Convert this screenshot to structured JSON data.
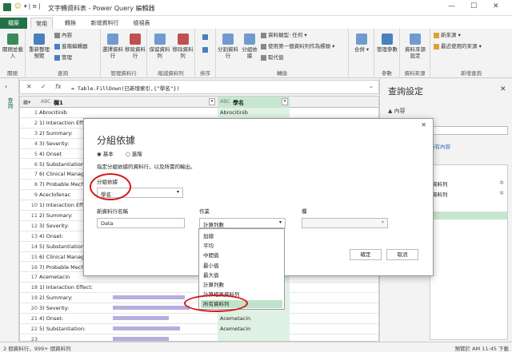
{
  "titlebar": {
    "title": "文字轉資料表 - Power Query 編輯器"
  },
  "tabs": [
    "檔案",
    "常用",
    "轉換",
    "新增資料行",
    "檢視表"
  ],
  "ribbon": {
    "groups": [
      {
        "label": "關閉",
        "buttons": [
          "關閉並載入"
        ]
      },
      {
        "label": "查詢",
        "buttons": [
          "重新整理預覽",
          "內容",
          "進階編輯器",
          "管理"
        ]
      },
      {
        "label": "管理資料行",
        "buttons": [
          "選擇資料行",
          "移除資料行"
        ]
      },
      {
        "label": "縮減資料列",
        "buttons": [
          "保留資料列",
          "移除資料列"
        ]
      },
      {
        "label": "排序",
        "buttons": []
      },
      {
        "label": "轉換",
        "buttons": [
          "分割資料行",
          "分組依據",
          "資料類型: 任何",
          "使用第一個資料列作為標頭",
          "取代值"
        ]
      },
      {
        "label": "",
        "buttons": [
          "合併"
        ]
      },
      {
        "label": "參數",
        "buttons": [
          "管理參數"
        ]
      },
      {
        "label": "資料來源",
        "buttons": [
          "資料來源設定"
        ]
      },
      {
        "label": "新增查詢",
        "buttons": [
          "新來源",
          "最近使用的來源"
        ]
      }
    ]
  },
  "nav": {
    "label": "查詢"
  },
  "formula": {
    "text": "= Table.FillDown(已新增索引,{\"學名\"})"
  },
  "grid": {
    "col1_header": "欄1",
    "col2_header": "學名",
    "rows": [
      {
        "n": "1",
        "c1": "Abrocitinib",
        "c2": "Abrocitinib"
      },
      {
        "n": "2",
        "c1": "1) Interaction Effe",
        "c2": ""
      },
      {
        "n": "3",
        "c1": "2) Summary:",
        "c2": ""
      },
      {
        "n": "4",
        "c1": "3) Severity:",
        "c2": ""
      },
      {
        "n": "5",
        "c1": "4) Onset",
        "c2": ""
      },
      {
        "n": "6",
        "c1": "5) Substantiation:",
        "c2": ""
      },
      {
        "n": "7",
        "c1": "6) Clinical Manage",
        "c2": ""
      },
      {
        "n": "8",
        "c1": "7) Probable Mech",
        "c2": ""
      },
      {
        "n": "9",
        "c1": "Aceclofenac",
        "c2": ""
      },
      {
        "n": "10",
        "c1": "1) Interaction Effe",
        "c2": ""
      },
      {
        "n": "11",
        "c1": "2) Summary:",
        "c2": ""
      },
      {
        "n": "12",
        "c1": "3) Severity:",
        "c2": ""
      },
      {
        "n": "13",
        "c1": "4) Onset:",
        "c2": ""
      },
      {
        "n": "14",
        "c1": "5) Substantiation:",
        "c2": ""
      },
      {
        "n": "15",
        "c1": "6) Clinical Manage",
        "c2": ""
      },
      {
        "n": "16",
        "c1": "7) Probable Mech",
        "c2": ""
      },
      {
        "n": "17",
        "c1": "Acemetacin",
        "c2": ""
      },
      {
        "n": "18",
        "c1": "1) Interaction Effect:",
        "c2": ""
      },
      {
        "n": "19",
        "c1": "2) Summary:",
        "c2": "Acemetacin"
      },
      {
        "n": "20",
        "c1": "3) Severity:",
        "c2": "Acemetacin"
      },
      {
        "n": "21",
        "c1": "4) Onset:",
        "c2": "Acemetacin"
      },
      {
        "n": "22",
        "c1": "5) Substantiation:",
        "c2": "Acemetacin"
      },
      {
        "n": "23",
        "c1": "",
        "c2": ""
      }
    ]
  },
  "qpane": {
    "title": "查詢設定",
    "props_label": "▲ 內容",
    "steps": [
      "資料列",
      "資料列"
    ],
    "all_props": "所有內容",
    "applied_label": "已套用的步驟"
  },
  "dialog": {
    "title": "分組依據",
    "radio_basic": "基本",
    "radio_adv": "進階",
    "desc": "指定分組依據的資料行，以及所需的輸出。",
    "groupby_label": "分組依據",
    "groupby_value": "學名",
    "newcol_label": "新資料行名稱",
    "newcol_value": "Data",
    "op_label": "作業",
    "op_value": "計算列數",
    "col_label": "欄",
    "ok": "確定",
    "cancel": "取消"
  },
  "dropdown": [
    "加總",
    "平均",
    "中間值",
    "最小值",
    "最大值",
    "計算列數",
    "計算相異資料列",
    "所有資料列"
  ],
  "status": {
    "left": "2 個資料行，999+ 個資料列",
    "right": "預覽於 AM 11:45 下載"
  }
}
